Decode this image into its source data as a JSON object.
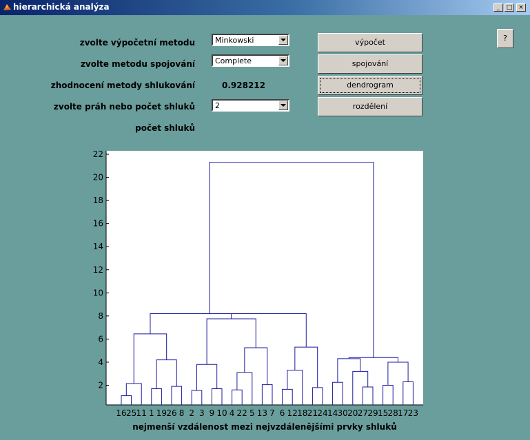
{
  "window": {
    "title": "hierarchická analýza"
  },
  "controls": {
    "method_label": "zvolte výpočetní metodu",
    "method_value": "Minkowski",
    "linkage_label": "zvolte metodu spojování",
    "linkage_value": "Complete",
    "eval_label": "zhodnocení metody shlukování",
    "eval_value": "0.928212",
    "threshold_label": "zvolte práh nebo počet shluků",
    "threshold_value": "2",
    "clusters_label": "počet shluků"
  },
  "buttons": {
    "compute": "výpočet",
    "link": "spojování",
    "dendrogram": "dendrogram",
    "split": "rozdělení",
    "help": "?"
  },
  "chart_data": {
    "type": "dendrogram",
    "xlabel": "nejmenší vzdálenost mezi nejvzdálenějšími prvky shluků",
    "ylim": [
      0.3,
      22.3
    ],
    "yticks": [
      2,
      4,
      6,
      8,
      10,
      12,
      14,
      16,
      18,
      20,
      22
    ],
    "leaf_labels": [
      "16",
      "25",
      "11",
      "1",
      "19",
      "26",
      "8",
      "2",
      "3",
      "9",
      "10",
      "4",
      "22",
      "5",
      "13",
      "7",
      "6",
      "12",
      "18",
      "21",
      "24",
      "14",
      "30",
      "20",
      "27",
      "29",
      "15",
      "28",
      "17",
      "23"
    ],
    "merges": [
      {
        "a": "16",
        "b": "25",
        "h": 1.1
      },
      {
        "a": "1",
        "b": "19",
        "h": 1.7
      },
      {
        "a": "26",
        "b": "8",
        "h": 1.9
      },
      {
        "a": "2",
        "b": "3",
        "h": 1.55
      },
      {
        "a": "9",
        "b": "10",
        "h": 1.7
      },
      {
        "a": "4",
        "b": "22",
        "h": 1.6
      },
      {
        "a": "13",
        "b": "7",
        "h": 2.05
      },
      {
        "a": "6",
        "b": "12",
        "h": 1.65
      },
      {
        "a": "21",
        "b": "24",
        "h": 1.8
      },
      {
        "a": "27",
        "b": "29",
        "h": 1.85
      },
      {
        "a": "15",
        "b": "28",
        "h": 2.0
      },
      {
        "a": "17",
        "b": "23",
        "h": 2.3
      },
      {
        "a": "16-25",
        "b": "11",
        "h": 2.15
      },
      {
        "a": "1-19",
        "b": "26-8",
        "h": 4.2
      },
      {
        "a": "2-3",
        "b": "9-10",
        "h": 3.8
      },
      {
        "a": "4-22",
        "b": "5",
        "h": 3.1
      },
      {
        "a": "4-22-5",
        "b": "13-7",
        "h": 5.25
      },
      {
        "a": "6-12",
        "b": "18",
        "h": 3.3
      },
      {
        "a": "6-12-18",
        "b": "21-24",
        "h": 5.3
      },
      {
        "a": "20",
        "b": "27-29",
        "h": 3.2
      },
      {
        "a": "14",
        "b": "30",
        "h": 2.25
      },
      {
        "a": "14-30",
        "b": "20-27-29",
        "h": 4.3
      },
      {
        "a": "15-28",
        "b": "17-23",
        "h": 4.0
      },
      {
        "a": "14..29",
        "b": "15..23",
        "h": 4.4
      },
      {
        "a": "16-25-11",
        "b": "1-19-26-8",
        "h": 6.45
      },
      {
        "a": "2-3-9-10",
        "b": "4-22-5-13-7",
        "h": 7.75
      },
      {
        "a": "6..18-21-24",
        "b": "2..7",
        "h": 8.2
      },
      {
        "a": "16..8",
        "b": "2..24",
        "h": 8.2
      },
      {
        "a": "16..24",
        "b": "14..23",
        "h": 21.3
      }
    ]
  }
}
